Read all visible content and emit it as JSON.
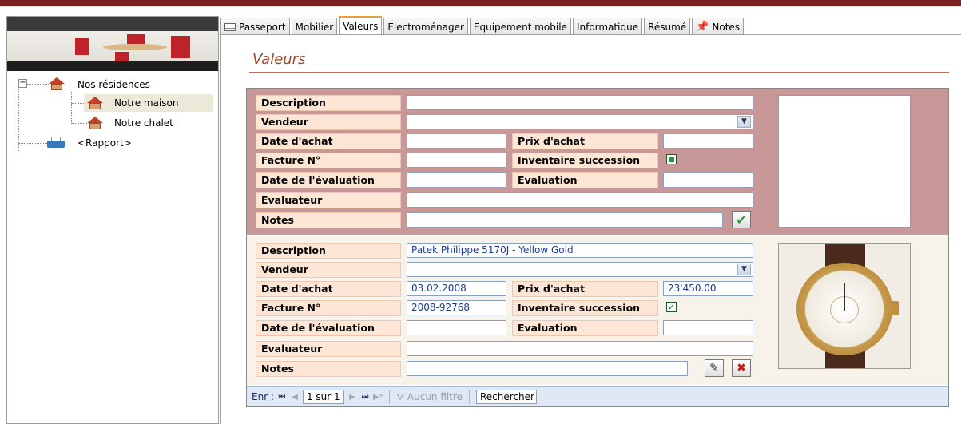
{
  "tabs": [
    {
      "label": "Passeport",
      "icon": "form-icon"
    },
    {
      "label": "Mobilier"
    },
    {
      "label": "Valeurs",
      "active": true
    },
    {
      "label": "Electroménager"
    },
    {
      "label": "Equipement mobile"
    },
    {
      "label": "Informatique"
    },
    {
      "label": "Résumé"
    },
    {
      "label": "Notes",
      "icon": "pushpin-icon"
    }
  ],
  "tree": {
    "root": "Nos résidences",
    "children": [
      "Notre maison",
      "Notre chalet"
    ],
    "selected": "Notre maison",
    "report": "<Rapport>"
  },
  "page_title": "Valeurs",
  "labels": {
    "description": "Description",
    "vendeur": "Vendeur",
    "date_achat": "Date d'achat",
    "prix_achat": "Prix d'achat",
    "facture": "Facture N°",
    "inventaire": "Inventaire succession",
    "date_evaluation": "Date de l'évaluation",
    "evaluation": "Evaluation",
    "evaluateur": "Evaluateur",
    "notes": "Notes"
  },
  "record_new": {
    "description": "",
    "vendeur": "",
    "date_achat": "",
    "prix_achat": "",
    "facture": "",
    "inventaire_succession": false,
    "date_evaluation": "",
    "evaluation": "",
    "evaluateur": "",
    "notes": ""
  },
  "record_1": {
    "description": "Patek Philippe 5170J - Yellow Gold",
    "vendeur": "",
    "date_achat": "03.02.2008",
    "prix_achat": "23'450.00",
    "facture": "2008-92768",
    "inventaire_succession": true,
    "date_evaluation": "",
    "evaluation": "",
    "evaluateur": "",
    "notes": ""
  },
  "navigation": {
    "label": "Enr :",
    "record": "1 sur 1",
    "filter": "Aucun filtre",
    "search": "Rechercher"
  },
  "colors": {
    "accent_dark_red": "#7a2020",
    "title_color": "#a0482a",
    "new_record_bg": "#c89898",
    "label_bg": "#fde6d6"
  }
}
